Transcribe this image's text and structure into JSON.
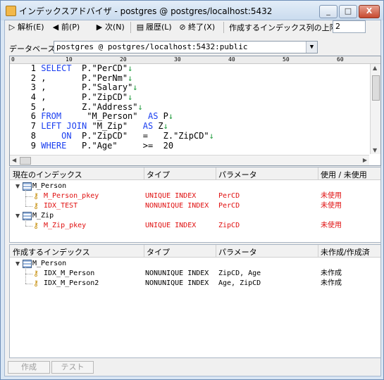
{
  "window": {
    "title": "インデックスアドバイザ - postgres @ postgres/localhost:5432",
    "minimize": "_",
    "maximize": "□",
    "close": "X"
  },
  "toolbar": {
    "analyze": "解析(E)",
    "prev": "前(P)",
    "next": "次(N)",
    "history": "履歴(L)",
    "exit": "終了(X)",
    "limit_label": "作成するインデックス列の上限数",
    "limit_value": "2"
  },
  "database": {
    "label": "データベース",
    "value": "postgres @ postgres/localhost:5432:public"
  },
  "editor": {
    "ruler": [
      "0",
      "10",
      "20",
      "30",
      "40",
      "50",
      "60"
    ],
    "lines": [
      {
        "n": "1",
        "parts": [
          {
            "t": "SELECT",
            "k": "kw"
          },
          {
            "t": "  P.\"PerCD\"",
            "k": "str"
          },
          {
            "t": "↓",
            "k": "eol"
          }
        ]
      },
      {
        "n": "2",
        "parts": [
          {
            "t": ",",
            "k": "str"
          },
          {
            "t": "       P.\"PerNm\"",
            "k": "str"
          },
          {
            "t": "↓",
            "k": "eol"
          }
        ]
      },
      {
        "n": "3",
        "parts": [
          {
            "t": ",",
            "k": "str"
          },
          {
            "t": "       P.\"Salary\"",
            "k": "str"
          },
          {
            "t": "↓",
            "k": "eol"
          }
        ]
      },
      {
        "n": "4",
        "parts": [
          {
            "t": ",",
            "k": "str"
          },
          {
            "t": "       P.\"ZipCD\"",
            "k": "str"
          },
          {
            "t": "↓",
            "k": "eol"
          }
        ]
      },
      {
        "n": "5",
        "parts": [
          {
            "t": ",",
            "k": "str"
          },
          {
            "t": "       Z.\"Address\"",
            "k": "str"
          },
          {
            "t": "↓",
            "k": "eol"
          }
        ]
      },
      {
        "n": "6",
        "parts": [
          {
            "t": "FROM",
            "k": "kw"
          },
          {
            "t": "     \"M_Person\"  ",
            "k": "str"
          },
          {
            "t": "AS",
            "k": "kw"
          },
          {
            "t": " P",
            "k": "str"
          },
          {
            "t": "↓",
            "k": "eol"
          }
        ]
      },
      {
        "n": "7",
        "parts": [
          {
            "t": "LEFT JOIN",
            "k": "kw"
          },
          {
            "t": " \"M_Zip\"   ",
            "k": "str"
          },
          {
            "t": "AS",
            "k": "kw"
          },
          {
            "t": " Z",
            "k": "str"
          },
          {
            "t": "↓",
            "k": "eol"
          }
        ]
      },
      {
        "n": "8",
        "parts": [
          {
            "t": "    ",
            "k": "str"
          },
          {
            "t": "ON",
            "k": "kw"
          },
          {
            "t": "  P.\"ZipCD\"   =   Z.\"ZipCD\"",
            "k": "str"
          },
          {
            "t": "↓",
            "k": "eol"
          }
        ]
      },
      {
        "n": "9",
        "parts": [
          {
            "t": "WHERE",
            "k": "kw"
          },
          {
            "t": "   P.\"Age\"     >=  20",
            "k": "str"
          }
        ]
      }
    ]
  },
  "current_indexes": {
    "headers": {
      "name": "現在のインデックス",
      "type": "タイプ",
      "params": "パラメータ",
      "usage": "使用 / 未使用"
    },
    "tables": [
      {
        "name": "M_Person",
        "indexes": [
          {
            "name": "M_Person_pkey",
            "type": "UNIQUE INDEX",
            "params": "PerCD",
            "usage": "未使用"
          },
          {
            "name": "IDX_TEST",
            "type": "NONUNIQUE INDEX",
            "params": "PerCD",
            "usage": "未使用"
          }
        ]
      },
      {
        "name": "M_Zip",
        "indexes": [
          {
            "name": "M_Zip_pkey",
            "type": "UNIQUE INDEX",
            "params": "ZipCD",
            "usage": "未使用"
          }
        ]
      }
    ]
  },
  "proposed_indexes": {
    "headers": {
      "name": "作成するインデックス",
      "type": "タイプ",
      "params": "パラメータ",
      "status": "未作成/作成済"
    },
    "tables": [
      {
        "name": "M_Person",
        "indexes": [
          {
            "name": "IDX_M_Person",
            "type": "NONUNIQUE INDEX",
            "params": "ZipCD, Age",
            "status": "未作成"
          },
          {
            "name": "IDX_M_Person2",
            "type": "NONUNIQUE INDEX",
            "params": "Age, ZipCD",
            "status": "未作成"
          }
        ]
      }
    ]
  },
  "footer": {
    "create": "作成",
    "test": "テスト"
  }
}
